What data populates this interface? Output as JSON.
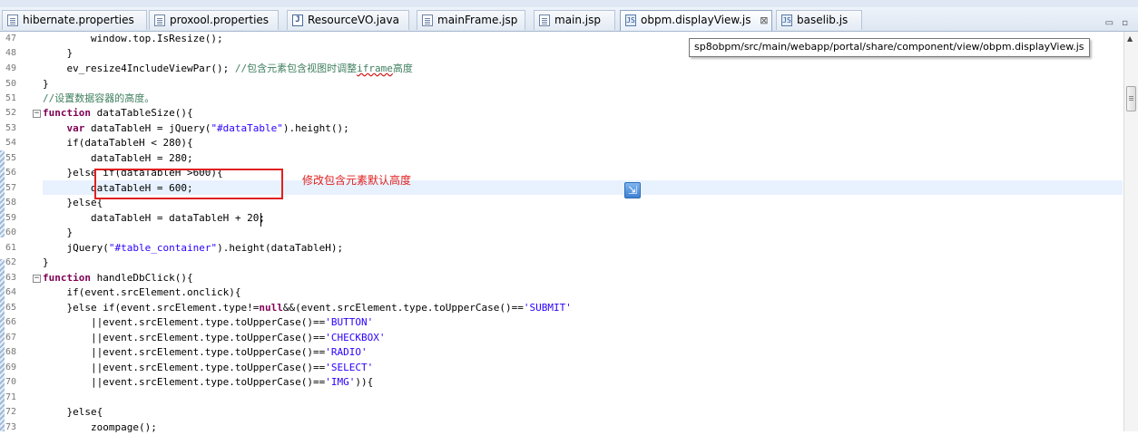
{
  "tabs": [
    {
      "label": "hibernate.properties",
      "icon": "properties-file-icon"
    },
    {
      "label": "proxool.properties",
      "icon": "properties-file-icon"
    },
    {
      "label": "ResourceVO.java",
      "icon": "java-file-icon"
    },
    {
      "label": "mainFrame.jsp",
      "icon": "jsp-file-icon"
    },
    {
      "label": "main.jsp",
      "icon": "jsp-file-icon"
    },
    {
      "label": "obpm.displayView.js",
      "icon": "js-file-icon",
      "active": true,
      "close": "⊠"
    },
    {
      "label": "baselib.js",
      "icon": "js-file-icon"
    }
  ],
  "window_controls": "▭ ▫",
  "tooltip": "sp8obpm/src/main/webapp/portal/share/component/view/obpm.displayView.js",
  "annotation": "修改包含元素默认高度",
  "line_numbers": [
    "47",
    "48",
    "49",
    "50",
    "51",
    "52",
    "53",
    "54",
    "55",
    "56",
    "57",
    "58",
    "59",
    "60",
    "61",
    "62",
    "63",
    "64",
    "65",
    "66",
    "67",
    "68",
    "69",
    "70",
    "71",
    "72",
    "73"
  ],
  "code": {
    "l47": "        window.top.IsResize();",
    "l48": "    }",
    "l49_a": "    ev_resize4IncludeViewPar(); ",
    "l49_b": "//包含元素包含视图时调整",
    "l49_c": "iframe",
    "l49_d": "高度",
    "l50": "}",
    "l51": "//设置数据容器的高度。",
    "l52_kw": "function",
    "l52": " dataTableSize(){",
    "l53_kw": "    var",
    "l53_a": " dataTableH = jQuery(",
    "l53_s": "\"#dataTable\"",
    "l53_b": ").height();",
    "l54": "    if(dataTableH < 280){",
    "l55": "        dataTableH = 280;",
    "l56": "    }else if(dataTableH >600){",
    "l57": "        dataTableH = 600;",
    "l58": "    }else{",
    "l59": "        dataTableH = dataTableH + 20;",
    "l60": "    }",
    "l61_a": "    jQuery(",
    "l61_s": "\"#table_container\"",
    "l61_b": ").height(dataTableH);",
    "l62": "}",
    "l63_kw": "function",
    "l63": " handleDbClick(){",
    "l64": "    if(event.srcElement.onclick){",
    "l65_a": "    }else if(event.srcElement.type!=",
    "l65_kw": "null",
    "l65_b": "&&(event.srcElement.type.toUpperCase()==",
    "l65_s": "'SUBMIT'",
    "l66_a": "        ||event.srcElement.type.toUpperCase()==",
    "l66_s": "'BUTTON'",
    "l67_s": "'CHECKBOX'",
    "l68_s": "'RADIO'",
    "l69_s": "'SELECT'",
    "l70_s": "'IMG'",
    "l70_b": "))",
    "l70_c": "{",
    "l71": "",
    "l72": "    }else{",
    "l73": "        zoompage();"
  }
}
